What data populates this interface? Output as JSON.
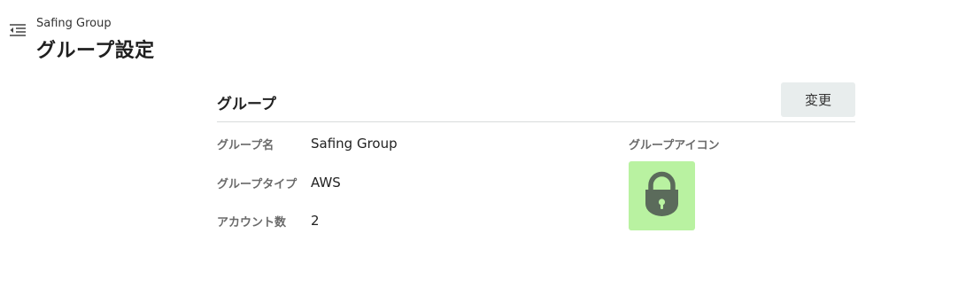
{
  "header": {
    "breadcrumb": "Safing Group",
    "title": "グループ設定"
  },
  "group_section": {
    "title": "グループ",
    "edit_label": "変更",
    "fields": [
      {
        "label": "グループ名",
        "value": "Safing Group"
      },
      {
        "label": "グループタイプ",
        "value": "AWS"
      },
      {
        "label": "アカウント数",
        "value": "2"
      }
    ],
    "icon_label": "グループアイコン",
    "icon": {
      "name": "lock-icon",
      "background": "#b9f2a1",
      "foreground": "#5b6b5b"
    }
  },
  "colors": {
    "button_bg": "#e8eded",
    "divider": "#d8dcdc",
    "label_text": "#6a6a6a"
  }
}
